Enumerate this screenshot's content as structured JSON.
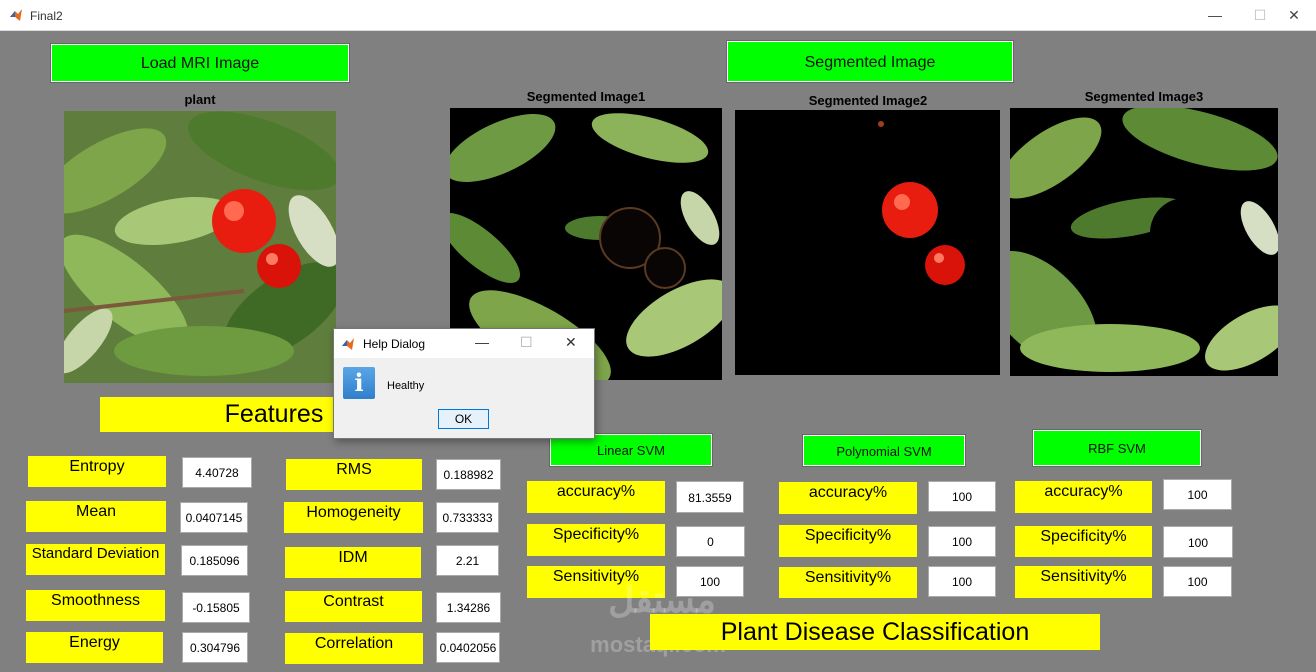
{
  "window": {
    "title": "Final2",
    "controls": [
      "—",
      "☐",
      "✕"
    ]
  },
  "buttons": {
    "load": "Load MRI Image",
    "segmented": "Segmented Image",
    "linear_svm": "Linear SVM",
    "poly_svm": "Polynomial SVM",
    "rbf_svm": "RBF SVM"
  },
  "captions": {
    "plant": "plant",
    "seg1": "Segmented Image1",
    "seg2": "Segmented Image2",
    "seg3": "Segmented Image3"
  },
  "features_title": "Features",
  "features_left": [
    {
      "label": "Entropy",
      "value": "4.40728"
    },
    {
      "label": "Mean",
      "value": "0.0407145"
    },
    {
      "label": "Standard Deviation",
      "value": "0.185096"
    },
    {
      "label": "Smoothness",
      "value": "-0.15805"
    },
    {
      "label": "Energy",
      "value": "0.304796"
    }
  ],
  "features_right": [
    {
      "label": "RMS",
      "value": "0.188982"
    },
    {
      "label": "Homogeneity",
      "value": "0.733333"
    },
    {
      "label": "IDM",
      "value": "2.21"
    },
    {
      "label": "Contrast",
      "value": "1.34286"
    },
    {
      "label": "Correlation",
      "value": "0.0402056"
    }
  ],
  "metrics_labels": [
    "accuracy%",
    "Specificity%",
    "Sensitivity%"
  ],
  "svm_results": {
    "linear": [
      "81.3559",
      "0",
      "100"
    ],
    "poly": [
      "100",
      "100",
      "100"
    ],
    "rbf": [
      "100",
      "100",
      "100"
    ]
  },
  "result_title": "Plant Disease Classification",
  "dialog": {
    "title": "Help Dialog",
    "message": "Healthy",
    "ok": "OK",
    "info_glyph": "i"
  },
  "watermark": {
    "arabic": "مستقل",
    "latin": "mostaql.com"
  },
  "icons": [
    "matlab-logo-icon",
    "minimize-icon",
    "maximize-icon",
    "close-icon",
    "info-icon"
  ]
}
